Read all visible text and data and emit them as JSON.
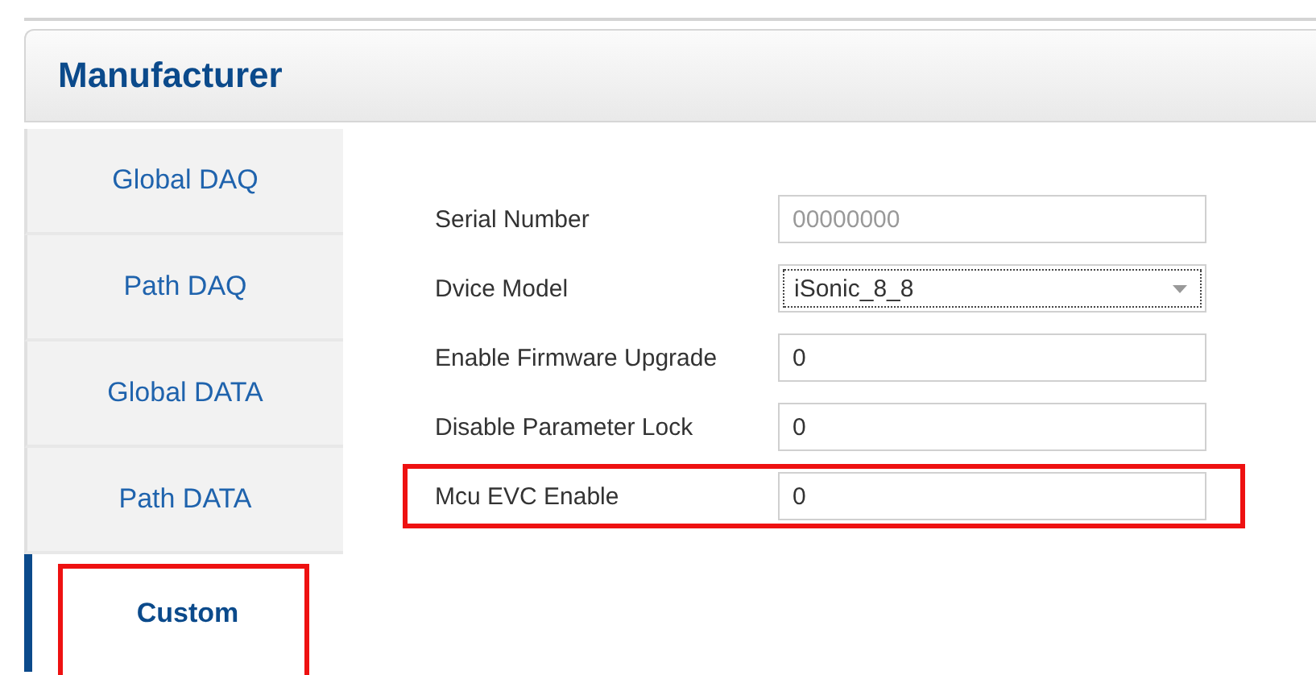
{
  "title": "Manufacturer",
  "tabs": [
    {
      "label": "Global DAQ",
      "selected": false,
      "highlighted": false
    },
    {
      "label": "Path DAQ",
      "selected": false,
      "highlighted": false
    },
    {
      "label": "Global DATA",
      "selected": false,
      "highlighted": false
    },
    {
      "label": "Path DATA",
      "selected": false,
      "highlighted": false
    },
    {
      "label": "Custom",
      "selected": true,
      "highlighted": true
    }
  ],
  "fields": [
    {
      "label": "Serial Number",
      "kind": "text",
      "value": "00000000",
      "disabled": true,
      "highlighted": false
    },
    {
      "label": "Dvice Model",
      "kind": "select",
      "value": "iSonic_8_8",
      "disabled": false,
      "highlighted": false
    },
    {
      "label": "Enable Firmware Upgrade",
      "kind": "text",
      "value": "0",
      "disabled": false,
      "highlighted": false
    },
    {
      "label": "Disable Parameter Lock",
      "kind": "text",
      "value": "0",
      "disabled": false,
      "highlighted": false
    },
    {
      "label": "Mcu EVC Enable",
      "kind": "text",
      "value": "0",
      "disabled": false,
      "highlighted": true
    }
  ]
}
